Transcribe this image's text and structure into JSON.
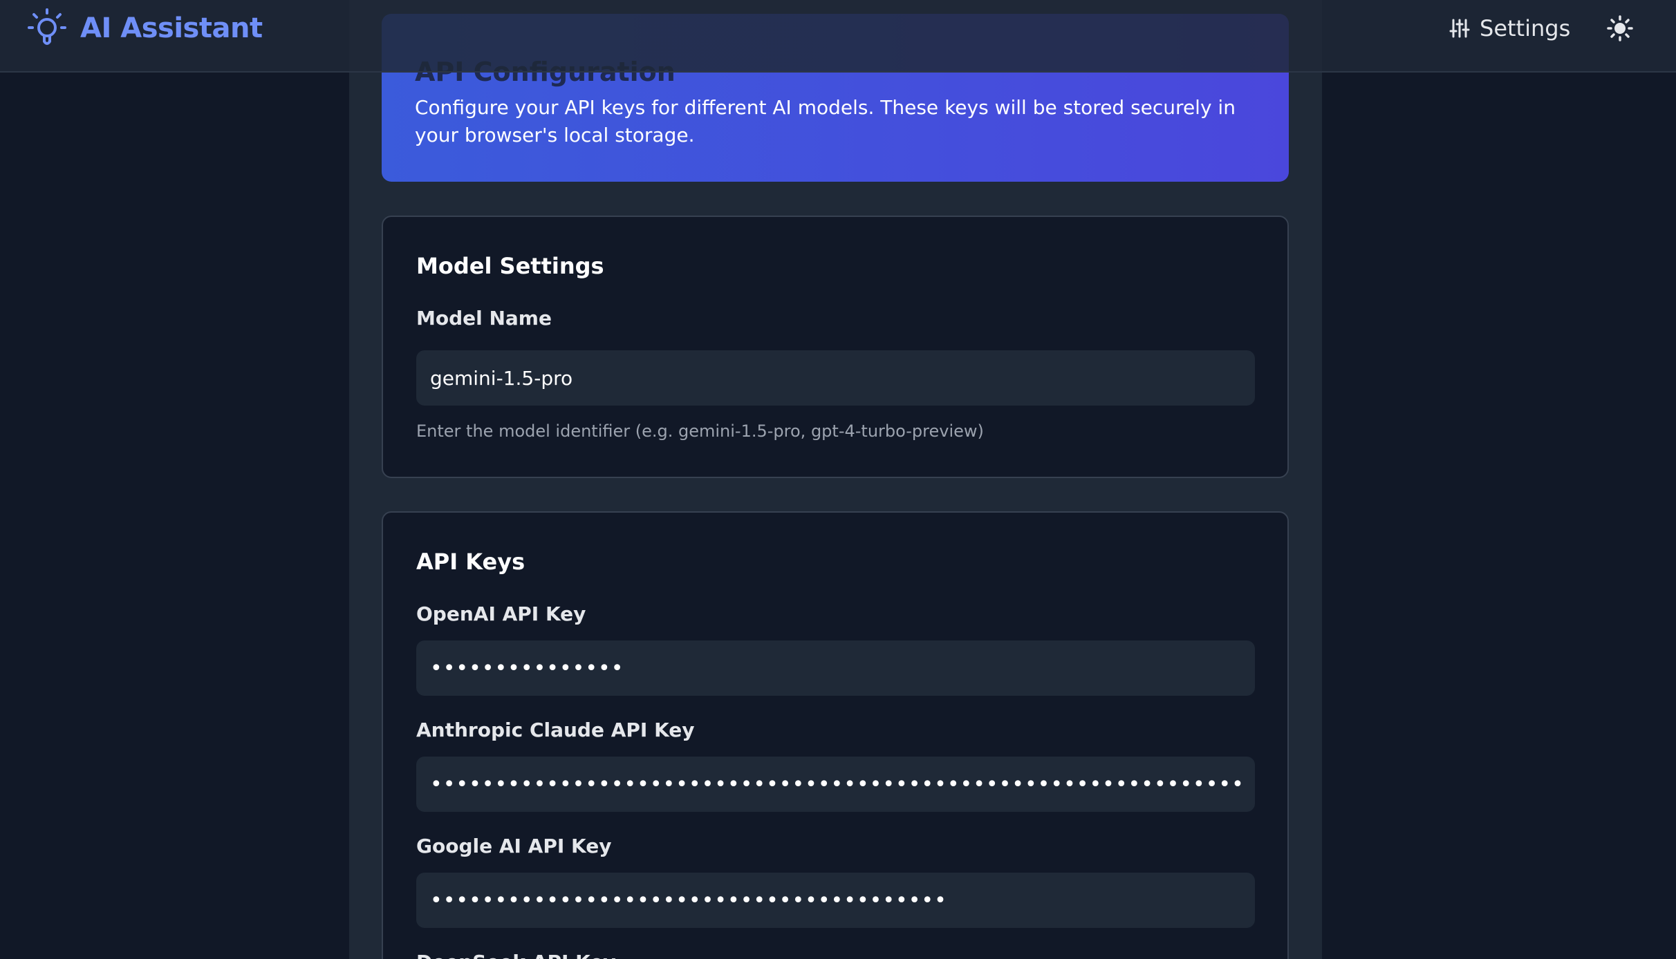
{
  "app": {
    "title": "AI Assistant",
    "brand_icon": "lightbulb-icon",
    "accent_color": "#6f8ff7"
  },
  "header": {
    "settings_label": "Settings",
    "settings_icon": "sliders-icon",
    "theme_toggle_icon": "sun-icon"
  },
  "banner": {
    "title": "API Configuration",
    "description": "Configure your API keys for different AI models. These keys will be stored securely in your browser's local storage.",
    "gradient_from": "#3b5bdb",
    "gradient_to": "#4a47dc"
  },
  "model_settings": {
    "heading": "Model Settings",
    "model_name_label": "Model Name",
    "model_name_value": "gemini-1.5-pro",
    "model_name_help": "Enter the model identifier (e.g. gemini-1.5-pro, gpt-4-turbo-preview)"
  },
  "api_keys": {
    "heading": "API Keys",
    "fields": [
      {
        "label": "OpenAI API Key",
        "masked_value": "•••••••••••••••"
      },
      {
        "label": "Anthropic Claude API Key",
        "masked_value": "••••••••••••••••••••••••••••••••••••••••••••••••••••••••••••••••••••••••••••••••••••••••"
      },
      {
        "label": "Google AI API Key",
        "masked_value": "••••••••••••••••••••••••••••••••••••••••"
      },
      {
        "label": "DeepSeek API Key",
        "masked_value": ""
      }
    ]
  }
}
